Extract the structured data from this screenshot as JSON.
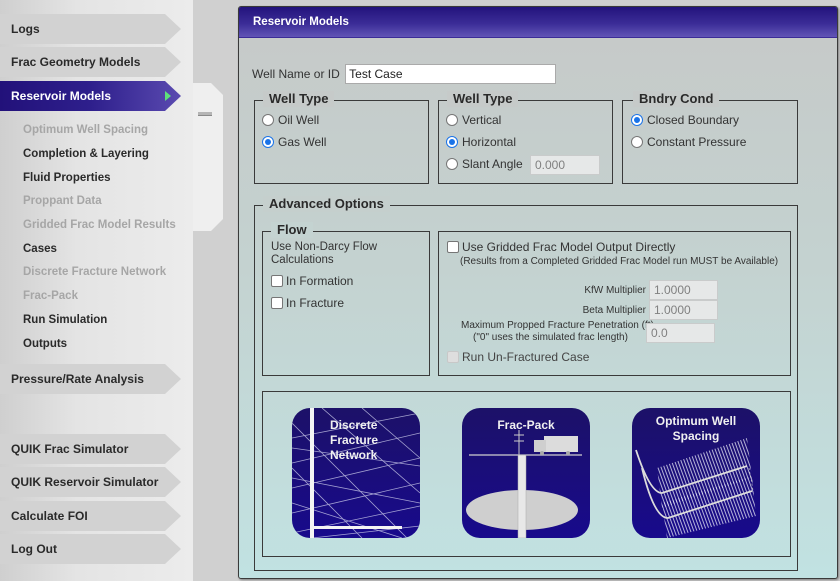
{
  "sidebar": {
    "top_items": [
      {
        "label": "Logs",
        "active": false
      },
      {
        "label": "Frac Geometry Models",
        "active": false
      },
      {
        "label": "Reservoir Models",
        "active": true
      }
    ],
    "sub_items": [
      {
        "label": "Optimum Well Spacing",
        "enabled": false
      },
      {
        "label": "Completion & Layering",
        "enabled": true
      },
      {
        "label": "Fluid Properties",
        "enabled": true
      },
      {
        "label": "Proppant Data",
        "enabled": false
      },
      {
        "label": "Gridded Frac Model Results",
        "enabled": false
      },
      {
        "label": "Cases",
        "enabled": true
      },
      {
        "label": "Discrete Fracture Network",
        "enabled": false
      },
      {
        "label": "Frac-Pack",
        "enabled": false
      },
      {
        "label": "Run Simulation",
        "enabled": true
      },
      {
        "label": "Outputs",
        "enabled": true
      }
    ],
    "mid_items": [
      {
        "label": "Pressure/Rate Analysis"
      }
    ],
    "bottom_items": [
      {
        "label": "QUIK Frac Simulator"
      },
      {
        "label": "QUIK Reservoir Simulator"
      },
      {
        "label": "Calculate FOI"
      },
      {
        "label": "Log Out"
      }
    ],
    "active_arrow_icon": "triangle-right-icon"
  },
  "panel": {
    "title": "Reservoir Models",
    "well_name_label": "Well Name or ID",
    "well_name_value": "Test Case",
    "fluid_type": {
      "legend": "Well Type",
      "options": [
        {
          "label": "Oil Well",
          "checked": false
        },
        {
          "label": "Gas Well",
          "checked": true
        }
      ]
    },
    "well_geometry": {
      "legend": "Well Type",
      "options": [
        {
          "label": "Vertical",
          "checked": false
        },
        {
          "label": "Horizontal",
          "checked": true
        },
        {
          "label": "Slant Angle",
          "checked": false
        }
      ],
      "slant_angle_value": "0.000"
    },
    "boundary": {
      "legend": "Bndry Cond",
      "options": [
        {
          "label": "Closed Boundary",
          "checked": true
        },
        {
          "label": "Constant Pressure",
          "checked": false
        }
      ]
    },
    "advanced": {
      "legend": "Advanced Options",
      "flow": {
        "legend": "Flow",
        "description": "Use Non-Darcy Flow Calculations",
        "checks": [
          {
            "label": "In Formation",
            "checked": false
          },
          {
            "label": "In Fracture",
            "checked": false
          }
        ]
      },
      "gridded": {
        "use_label": "Use Gridded Frac Model Output Directly",
        "use_checked": false,
        "note": "(Results from a Completed Gridded Frac Model run MUST be Available)",
        "kfw_label": "KfW Multiplier",
        "kfw_value": "1.0000",
        "beta_label": "Beta Multiplier",
        "beta_value": "1.0000",
        "max_pen_label": "Maximum Propped Fracture Penetration (ft)",
        "max_pen_note": "(\"0\" uses the simulated frac length)",
        "max_pen_value": "0.0",
        "unfractured_label": "Run Un-Fractured Case",
        "unfractured_checked": false,
        "unfractured_enabled": false
      },
      "tiles": [
        {
          "label": "Discrete Fracture Network",
          "lines": [
            "Discrete",
            "Fracture",
            "Network"
          ],
          "icon": "discrete-fracture-network-icon"
        },
        {
          "label": "Frac-Pack",
          "lines": [
            "Frac-Pack"
          ],
          "icon": "frac-pack-icon"
        },
        {
          "label": "Optimum Well Spacing",
          "lines": [
            "Optimum Well",
            "Spacing"
          ],
          "icon": "optimum-well-spacing-icon"
        }
      ]
    }
  }
}
